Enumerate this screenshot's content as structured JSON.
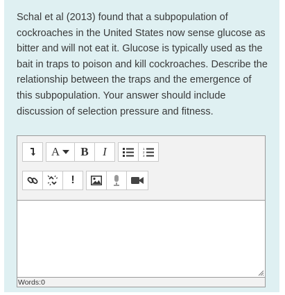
{
  "question": {
    "text": "Schal et al (2013) found that a subpopulation of cockroaches in the United States now sense glucose as bitter and will not eat it. Glucose is typically used as the bait in traps to poison and kill cockroaches. Describe the relationship between the traps and the emergence of this subpopulation. Your answer should include discussion of selection pressure and fitness."
  },
  "toolbar": {
    "row1": [
      {
        "name": "collapse-toolbar-button",
        "icon": "arrow-down-icon"
      },
      {
        "name": "font-color-button",
        "label": "A"
      },
      {
        "name": "bold-button",
        "label": "B"
      },
      {
        "name": "italic-button",
        "label": "I"
      },
      {
        "name": "unordered-list-button",
        "icon": "bullet-list-icon"
      },
      {
        "name": "ordered-list-button",
        "icon": "numbered-list-icon"
      }
    ],
    "row2": [
      {
        "name": "link-button",
        "icon": "link-icon"
      },
      {
        "name": "unlink-button",
        "icon": "unlink-icon"
      },
      {
        "name": "emoticon-button",
        "label": "!"
      },
      {
        "name": "image-button",
        "icon": "image-icon"
      },
      {
        "name": "record-audio-button",
        "icon": "microphone-icon"
      },
      {
        "name": "record-video-button",
        "icon": "video-camera-icon"
      }
    ]
  },
  "editor": {
    "value": "",
    "word_count_label": "Words:0"
  },
  "colors": {
    "panel_background": "#dff0f2",
    "toolbar_background": "#f2f2f2",
    "border": "#9a9a9a",
    "text": "#3a3a3a"
  }
}
